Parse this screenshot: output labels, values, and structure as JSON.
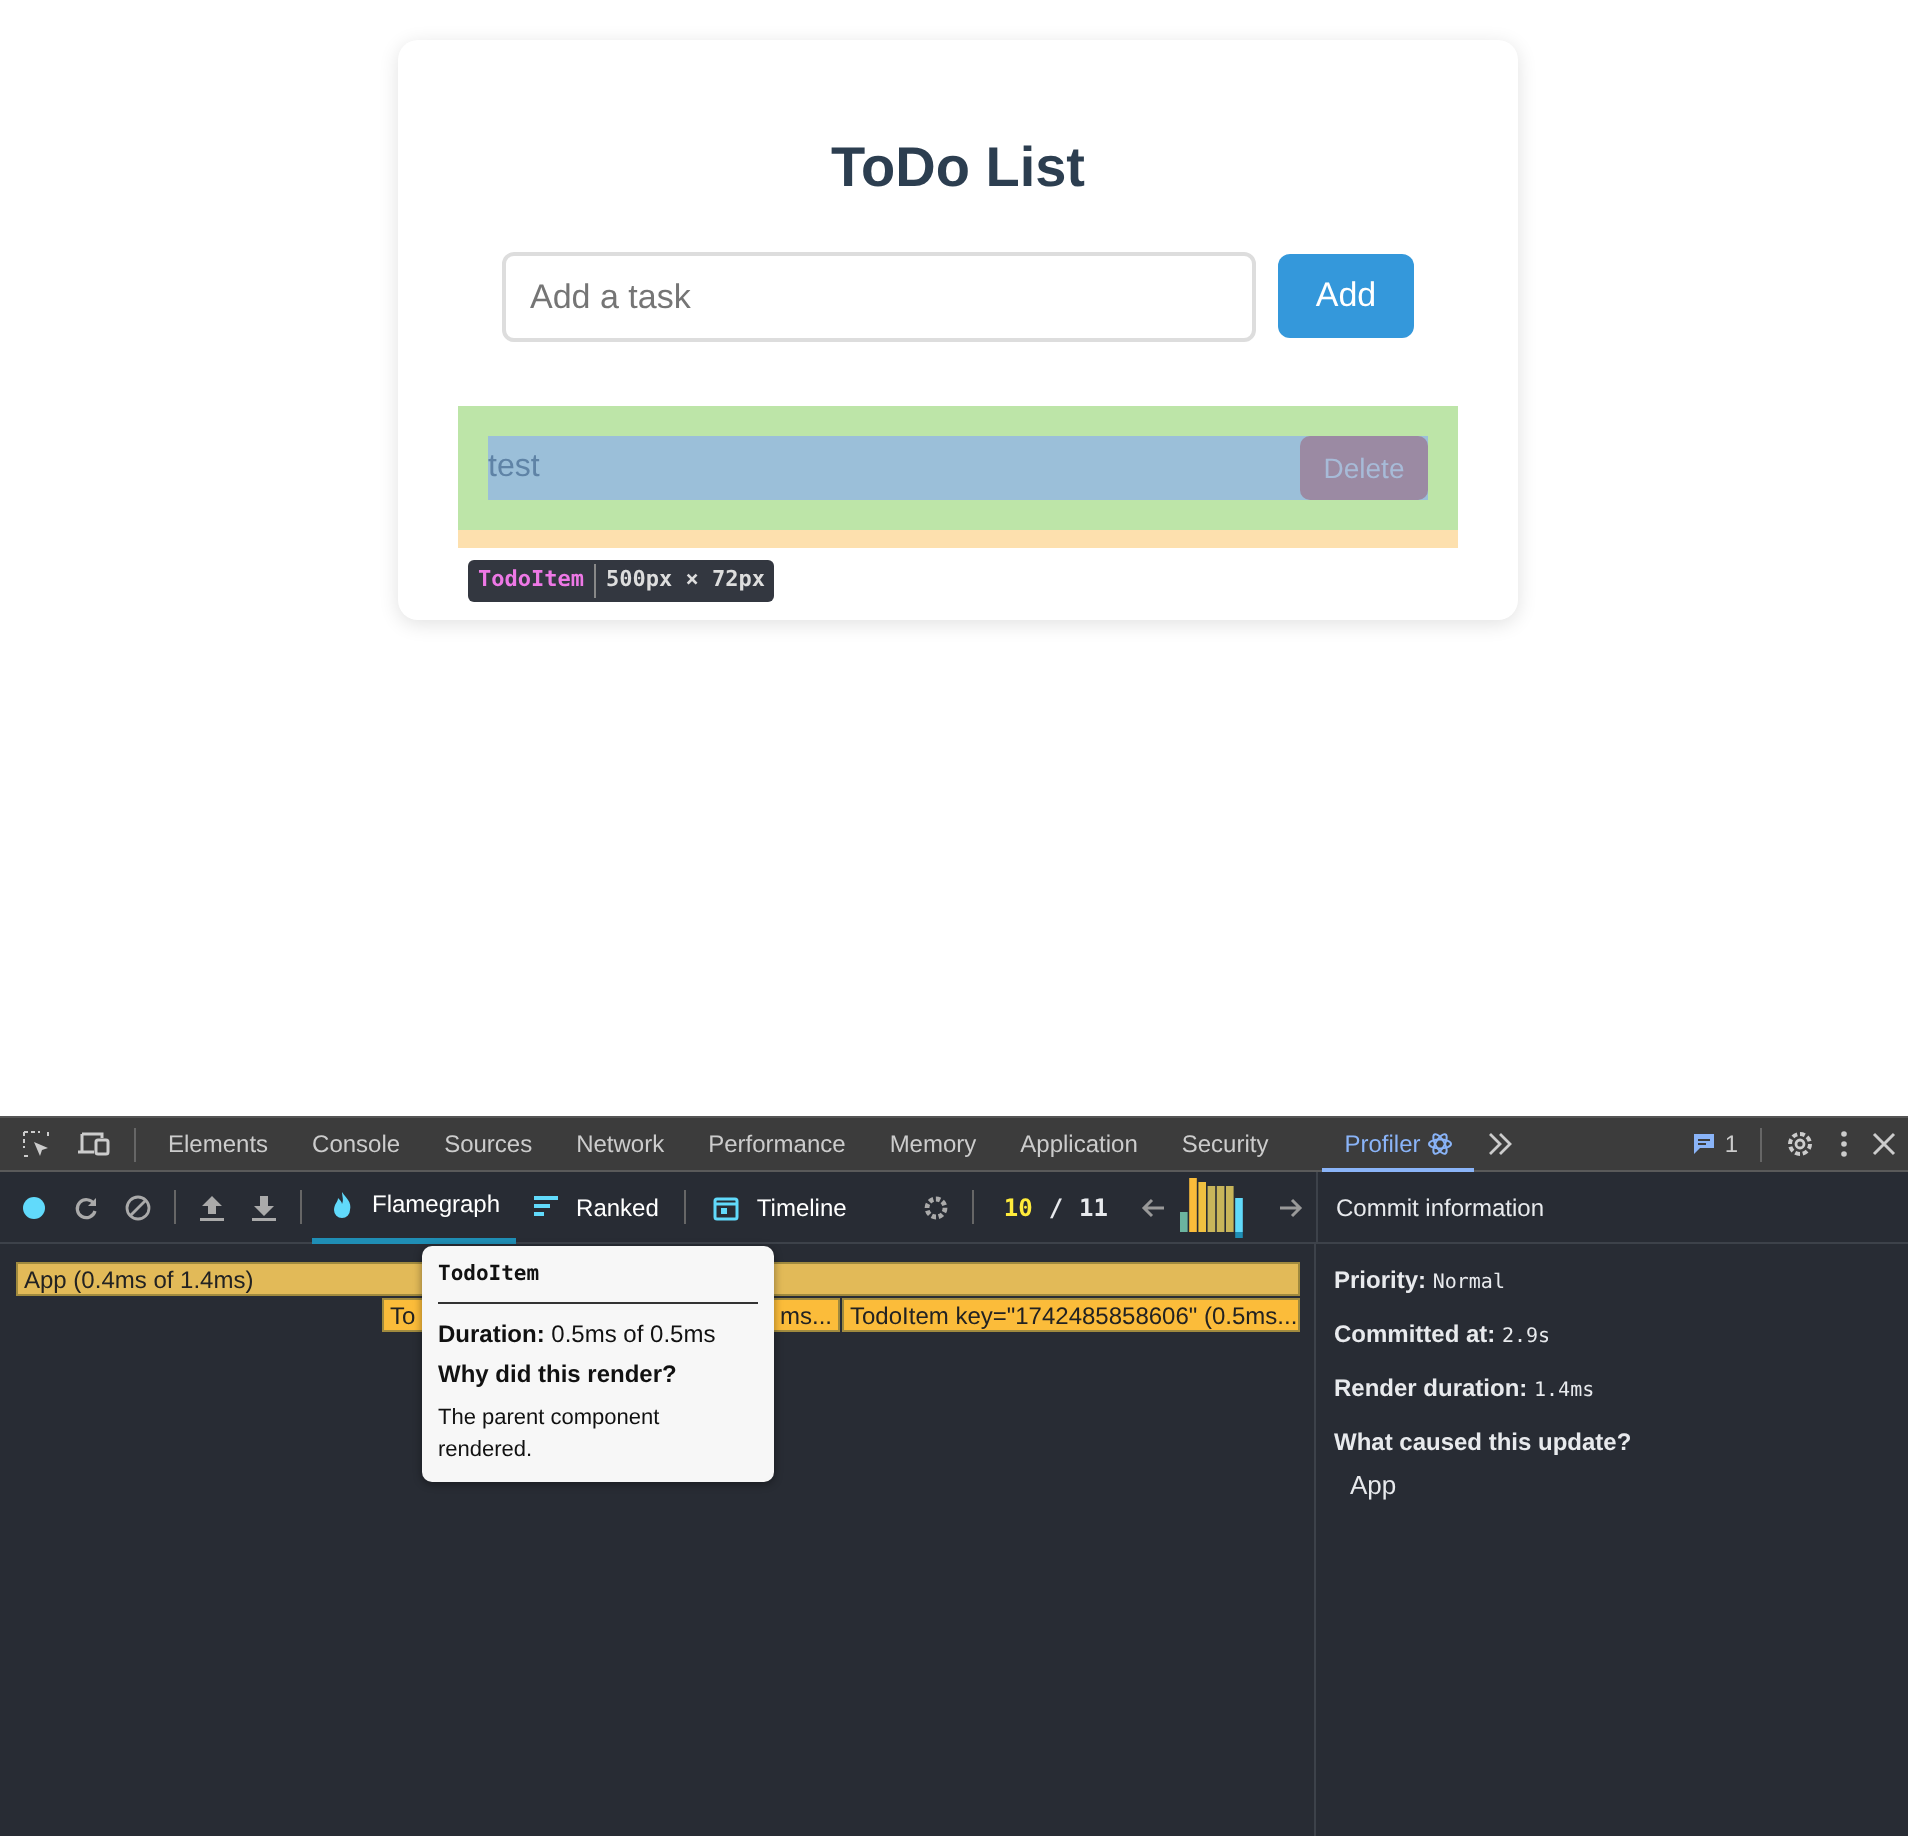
{
  "app": {
    "title": "ToDo List",
    "input": {
      "placeholder": "Add a task"
    },
    "add_button": "Add",
    "items": [
      {
        "text": "test",
        "delete_button": "Delete"
      }
    ],
    "inspector_label": {
      "component": "TodoItem",
      "size": "500px × 72px"
    }
  },
  "devtools": {
    "tabs": [
      {
        "label": "Elements",
        "selected": false
      },
      {
        "label": "Console",
        "selected": false
      },
      {
        "label": "Sources",
        "selected": false
      },
      {
        "label": "Network",
        "selected": false
      },
      {
        "label": "Performance",
        "selected": false
      },
      {
        "label": "Memory",
        "selected": false
      },
      {
        "label": "Application",
        "selected": false
      },
      {
        "label": "Security",
        "selected": false
      },
      {
        "label": "Profiler",
        "selected": true
      }
    ],
    "issues_count": "1",
    "profiler_tabs": [
      {
        "label": "Flamegraph",
        "kind": "flame",
        "selected": true
      },
      {
        "label": "Ranked",
        "kind": "ranked",
        "selected": false
      },
      {
        "label": "Timeline",
        "kind": "timeline",
        "selected": false
      }
    ],
    "commit_current": "10",
    "commit_separator": "/",
    "commit_total": "11",
    "flamegraph": [
      {
        "text": "App (0.4ms of 1.4ms)",
        "kind": "root"
      },
      {
        "text_start": "To",
        "text_end": "ms...",
        "kind": "child"
      },
      {
        "text": "TodoItem key=\"1742485858606\" (0.5ms...",
        "kind": "child"
      }
    ],
    "tooltip": {
      "title": "TodoItem",
      "duration_label": "Duration:",
      "duration_value": "0.5ms of 0.5ms",
      "why_heading": "Why did this render?",
      "reason": "The parent component rendered."
    },
    "commit_info": {
      "heading": "Commit information",
      "priority_label": "Priority:",
      "priority_value": "Normal",
      "committed_label": "Committed at:",
      "committed_value": "2.9s",
      "render_label": "Render duration:",
      "render_value": "1.4ms",
      "cause_heading": "What caused this update?",
      "cause": "App"
    }
  }
}
